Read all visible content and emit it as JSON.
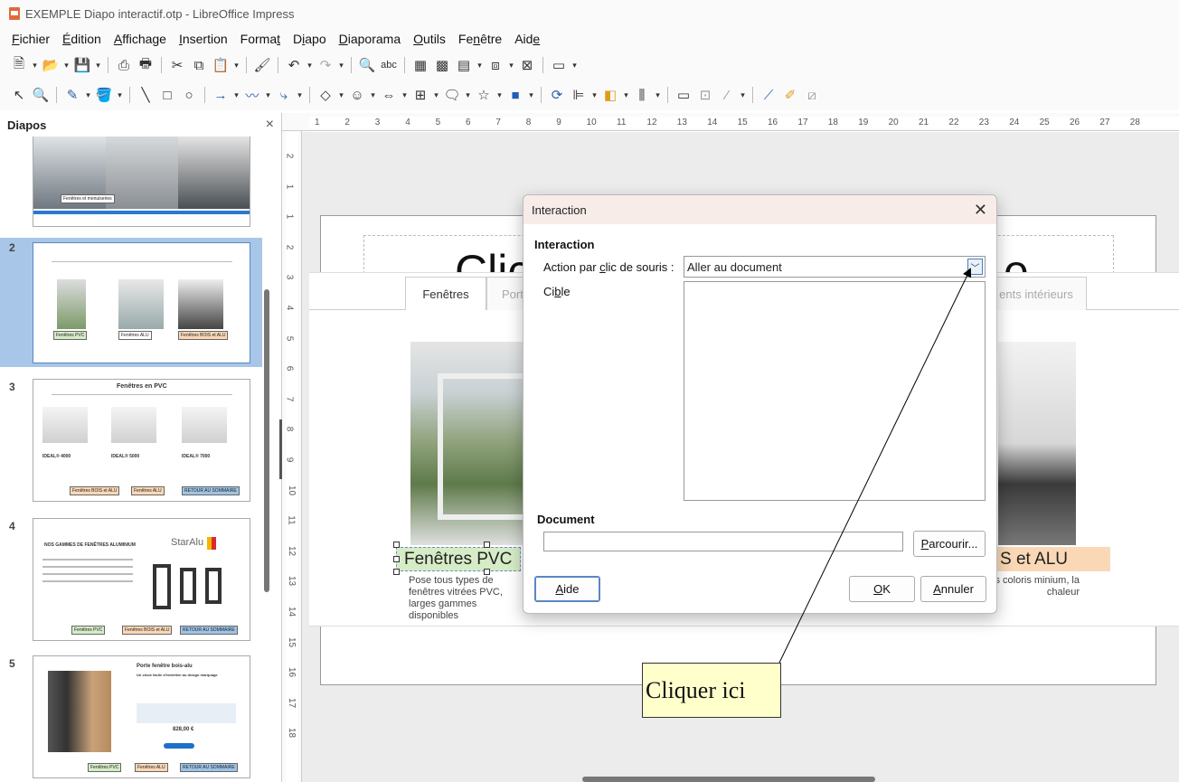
{
  "window": {
    "title": "EXEMPLE Diapo interactif.otp - LibreOffice Impress"
  },
  "menubar": {
    "items": [
      {
        "pre": "",
        "u": "F",
        "post": "ichier"
      },
      {
        "pre": "",
        "u": "É",
        "post": "dition"
      },
      {
        "pre": "",
        "u": "A",
        "post": "ffichage"
      },
      {
        "pre": "",
        "u": "I",
        "post": "nsertion"
      },
      {
        "pre": "Forma",
        "u": "t",
        "post": ""
      },
      {
        "pre": "D",
        "u": "i",
        "post": "apo"
      },
      {
        "pre": "",
        "u": "D",
        "post": "iaporama"
      },
      {
        "pre": "",
        "u": "O",
        "post": "utils"
      },
      {
        "pre": "Fe",
        "u": "n",
        "post": "être"
      },
      {
        "pre": "Aid",
        "u": "e",
        "post": ""
      }
    ]
  },
  "slides_pane": {
    "title": "Diapos",
    "close": "×",
    "slides": [
      {
        "number": "",
        "tags": [
          "Fenêtres et menuiseries"
        ]
      },
      {
        "number": "2",
        "tags": [
          "Fenêtres PVC",
          "Fenêtres ALU",
          "Fenêtres BOIS et ALU"
        ]
      },
      {
        "number": "3",
        "title": "Fenêtres en PVC",
        "products": [
          "IDEAL® 4000",
          "IDEAL® 5000",
          "IDEAL® 7000"
        ],
        "tags": [
          "Fenêtres BOIS et ALU",
          "Fenêtres ALU",
          "RETOUR AU SOMMAIRE"
        ]
      },
      {
        "number": "4",
        "title": "NOS GAMMES DE FENÊTRES ALUMINIUM",
        "brand": "StarAlu",
        "tags": [
          "Fenêtres PVC",
          "Fenêtres BOIS et ALU",
          "RETOUR AU SOMMAIRE"
        ]
      },
      {
        "number": "5",
        "title": "Porte fenêtre bois-alu",
        "subtitle": "Un choix facile d'entretien au design marquage",
        "price": "828,00 €",
        "tags": [
          "Fenêtres PVC",
          "Fenêtres ALU",
          "RETOUR AU SOMMAIRE"
        ]
      }
    ]
  },
  "ruler": {
    "h_ticks": [
      "1",
      "2",
      "3",
      "4",
      "5",
      "6",
      "7",
      "8",
      "9",
      "10",
      "11",
      "12",
      "13",
      "14",
      "15",
      "16",
      "17",
      "18",
      "19",
      "20",
      "21",
      "22",
      "23",
      "24",
      "25",
      "26",
      "27",
      "28"
    ],
    "v_ticks": [
      "2",
      "1",
      "1",
      "2",
      "3",
      "4",
      "5",
      "6",
      "7",
      "8",
      "9",
      "10",
      "11",
      "12",
      "13",
      "14",
      "15",
      "16",
      "17",
      "18"
    ]
  },
  "slide": {
    "title_left": "Clic",
    "title_right": "e",
    "tabs": [
      "Fenêtres",
      "Port",
      "ents intérieurs"
    ],
    "label_pvc": "Fenêtres PVC",
    "label_alu": "S  et ALU",
    "desc_left": "Pose tous types de fenêtres vitrées PVC, larges gammes disponibles",
    "desc_right": "ortes et baies , divers coloris minium, la chaleur"
  },
  "dialog": {
    "title": "Interaction",
    "close": "✕",
    "section_interaction": "Interaction",
    "action_label_pre": "Action par ",
    "action_label_u": "c",
    "action_label_post": "lic de souris :",
    "action_value": "Aller au document",
    "target_label_pre": "Ci",
    "target_label_u": "b",
    "target_label_post": "le",
    "section_document": "Document",
    "document_value": "",
    "browse_pre": "",
    "browse_u": "P",
    "browse_post": "arcourir...",
    "help_pre": "",
    "help_u": "A",
    "help_post": "ide",
    "ok_pre": "",
    "ok_u": "O",
    "ok_post": "K",
    "cancel_pre": "",
    "cancel_u": "A",
    "cancel_post": "nnuler"
  },
  "annotation": {
    "text": "Cliquer ici"
  }
}
